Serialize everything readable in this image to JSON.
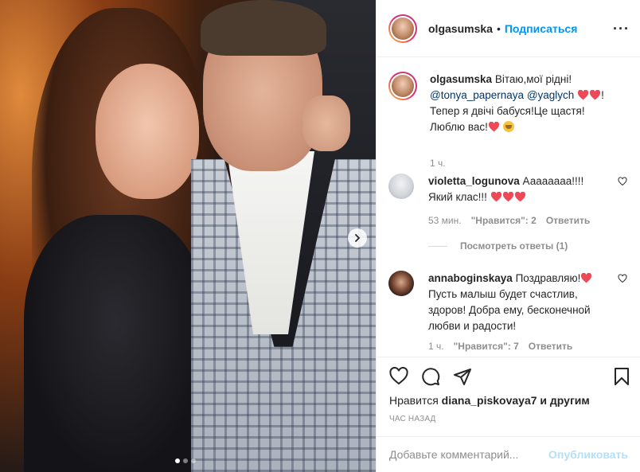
{
  "header": {
    "username": "olgasumska",
    "separator": "•",
    "follow_label": "Подписаться",
    "more_icon": "more-horizontal-icon"
  },
  "caption": {
    "username": "olgasumska",
    "text_1": "Вітаю,мої рідні!",
    "mention_1": "@tonya_papernaya",
    "mention_2": "@yaglych",
    "text_2": "!",
    "text_3": "Тепер я двічі бабуся!Це щастя! Люблю вас!",
    "time": "1 ч."
  },
  "comments": [
    {
      "username": "violetta_logunova",
      "text": "Аааааааа!!!! Який клас!!!",
      "time": "53 мин.",
      "likes": "\"Нравится\": 2",
      "reply": "Ответить"
    },
    {
      "username": "annaboginskaya",
      "text": "Поздравляю!",
      "text_2": "Пусть малыш будет счастлив, здоров! Добра ему, бесконечной любви и радости!",
      "time": "1 ч.",
      "likes": "\"Нравится\": 7",
      "reply": "Ответить"
    }
  ],
  "replies_label": "Посмотреть ответы (1)",
  "likes": {
    "prefix": "Нравится",
    "user": "diana_piskovaya7",
    "suffix": "и другим"
  },
  "date": "ЧАС НАЗАД",
  "add_comment": {
    "placeholder": "Добавьте комментарий...",
    "publish_label": "Опубликовать"
  },
  "carousel": {
    "total_slides": 3,
    "current_slide": 1
  },
  "colors": {
    "link_blue": "#0095f6",
    "mention": "#00376b",
    "heart_red": "#ed4956",
    "publish_disabled": "#b2dffc",
    "muted": "#8e8e8e"
  }
}
